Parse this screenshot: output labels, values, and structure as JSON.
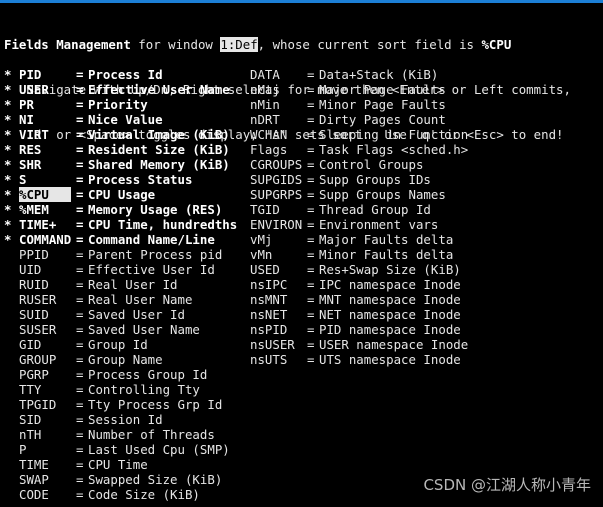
{
  "header": {
    "title_bold": "Fields Management",
    "title_mid": " for window ",
    "window_name": "1:Def",
    "title_tail": ", whose current sort field is ",
    "sort_field": "%CPU",
    "help_line_1": "   Navigate with Up/Dn, Right selects for move then <Enter> or Left commits,",
    "help_line_2": "   'd' or <Space> toggles display, 's' sets sort.  Use 'q' or <Esc> to end!"
  },
  "left_fields": [
    {
      "star": "*",
      "name": "PID",
      "desc": "Process Id",
      "displayed": true,
      "selected": false
    },
    {
      "star": "*",
      "name": "USER",
      "desc": "Effective User Name",
      "displayed": true,
      "selected": false
    },
    {
      "star": "*",
      "name": "PR",
      "desc": "Priority",
      "displayed": true,
      "selected": false
    },
    {
      "star": "*",
      "name": "NI",
      "desc": "Nice Value",
      "displayed": true,
      "selected": false
    },
    {
      "star": "*",
      "name": "VIRT",
      "desc": "Virtual Image (KiB)",
      "displayed": true,
      "selected": false
    },
    {
      "star": "*",
      "name": "RES",
      "desc": "Resident Size (KiB)",
      "displayed": true,
      "selected": false
    },
    {
      "star": "*",
      "name": "SHR",
      "desc": "Shared Memory (KiB)",
      "displayed": true,
      "selected": false
    },
    {
      "star": "*",
      "name": "S",
      "desc": "Process Status",
      "displayed": true,
      "selected": false
    },
    {
      "star": "*",
      "name": "%CPU",
      "desc": "CPU Usage",
      "displayed": true,
      "selected": true
    },
    {
      "star": "*",
      "name": "%MEM",
      "desc": "Memory Usage (RES)",
      "displayed": true,
      "selected": false
    },
    {
      "star": "*",
      "name": "TIME+",
      "desc": "CPU Time, hundredths",
      "displayed": true,
      "selected": false
    },
    {
      "star": "*",
      "name": "COMMAND",
      "desc": "Command Name/Line",
      "displayed": true,
      "selected": false
    },
    {
      "star": "",
      "name": "PPID",
      "desc": "Parent Process pid",
      "displayed": false,
      "selected": false
    },
    {
      "star": "",
      "name": "UID",
      "desc": "Effective User Id",
      "displayed": false,
      "selected": false
    },
    {
      "star": "",
      "name": "RUID",
      "desc": "Real User Id",
      "displayed": false,
      "selected": false
    },
    {
      "star": "",
      "name": "RUSER",
      "desc": "Real User Name",
      "displayed": false,
      "selected": false
    },
    {
      "star": "",
      "name": "SUID",
      "desc": "Saved User Id",
      "displayed": false,
      "selected": false
    },
    {
      "star": "",
      "name": "SUSER",
      "desc": "Saved User Name",
      "displayed": false,
      "selected": false
    },
    {
      "star": "",
      "name": "GID",
      "desc": "Group Id",
      "displayed": false,
      "selected": false
    },
    {
      "star": "",
      "name": "GROUP",
      "desc": "Group Name",
      "displayed": false,
      "selected": false
    },
    {
      "star": "",
      "name": "PGRP",
      "desc": "Process Group Id",
      "displayed": false,
      "selected": false
    },
    {
      "star": "",
      "name": "TTY",
      "desc": "Controlling Tty",
      "displayed": false,
      "selected": false
    },
    {
      "star": "",
      "name": "TPGID",
      "desc": "Tty Process Grp Id",
      "displayed": false,
      "selected": false
    },
    {
      "star": "",
      "name": "SID",
      "desc": "Session Id",
      "displayed": false,
      "selected": false
    },
    {
      "star": "",
      "name": "nTH",
      "desc": "Number of Threads",
      "displayed": false,
      "selected": false
    },
    {
      "star": "",
      "name": "P",
      "desc": "Last Used Cpu (SMP)",
      "displayed": false,
      "selected": false
    },
    {
      "star": "",
      "name": "TIME",
      "desc": "CPU Time",
      "displayed": false,
      "selected": false
    },
    {
      "star": "",
      "name": "SWAP",
      "desc": "Swapped Size (KiB)",
      "displayed": false,
      "selected": false
    },
    {
      "star": "",
      "name": "CODE",
      "desc": "Code Size (KiB)",
      "displayed": false,
      "selected": false
    }
  ],
  "right_fields": [
    {
      "name": "DATA",
      "desc": "Data+Stack (KiB)"
    },
    {
      "name": "nMaj",
      "desc": "Major Page Faults"
    },
    {
      "name": "nMin",
      "desc": "Minor Page Faults"
    },
    {
      "name": "nDRT",
      "desc": "Dirty Pages Count"
    },
    {
      "name": "WCHAN",
      "desc": "Sleeping in Function"
    },
    {
      "name": "Flags",
      "desc": "Task Flags <sched.h>"
    },
    {
      "name": "CGROUPS",
      "desc": "Control Groups"
    },
    {
      "name": "SUPGIDS",
      "desc": "Supp Groups IDs"
    },
    {
      "name": "SUPGRPS",
      "desc": "Supp Groups Names"
    },
    {
      "name": "TGID",
      "desc": "Thread Group Id"
    },
    {
      "name": "ENVIRON",
      "desc": "Environment vars"
    },
    {
      "name": "vMj",
      "desc": "Major Faults delta"
    },
    {
      "name": "vMn",
      "desc": "Minor Faults delta"
    },
    {
      "name": "USED",
      "desc": "Res+Swap Size (KiB)"
    },
    {
      "name": "nsIPC",
      "desc": "IPC namespace Inode"
    },
    {
      "name": "nsMNT",
      "desc": "MNT namespace Inode"
    },
    {
      "name": "nsNET",
      "desc": "NET namespace Inode"
    },
    {
      "name": "nsPID",
      "desc": "PID namespace Inode"
    },
    {
      "name": "nsUSER",
      "desc": "USER namespace Inode"
    },
    {
      "name": "nsUTS",
      "desc": "UTS namespace Inode"
    }
  ],
  "equals": "=",
  "watermark": "CSDN @江湖人称小青年",
  "colors": {
    "background": "#000000",
    "text": "#e6e6e6",
    "highlight_bg": "#e6e6e6",
    "top_bar": "#1c7fd6"
  }
}
